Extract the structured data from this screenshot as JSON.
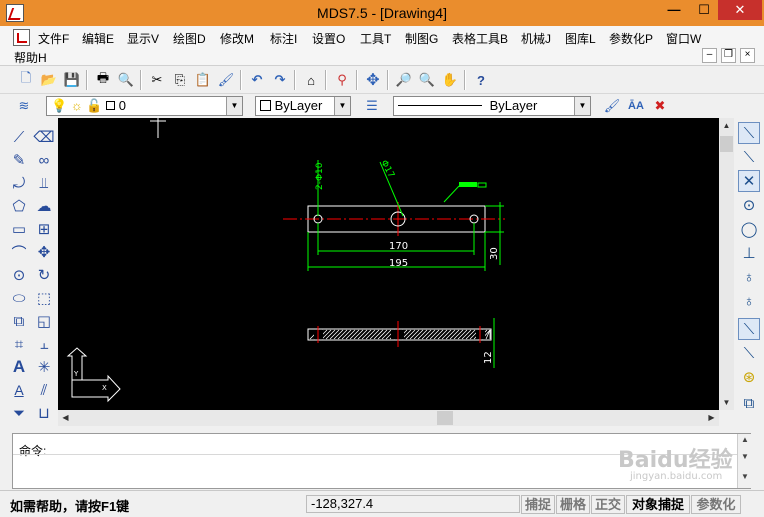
{
  "window": {
    "title": "MDS7.5 - [Drawing4]"
  },
  "menu": {
    "items": [
      "文件F",
      "编辑E",
      "显示V",
      "绘图D",
      "修改M",
      "标注I",
      "设置O",
      "工具T",
      "制图G",
      "表格工具B",
      "机械J",
      "图库L",
      "参数化P",
      "窗口W",
      "帮助H"
    ]
  },
  "props": {
    "layer": "0",
    "color": "ByLayer",
    "linetype": "ByLayer"
  },
  "drawing": {
    "dim_hole": "2-Φ10",
    "dim_center": "Φ17",
    "dim_170": "170",
    "dim_195": "195",
    "dim_30": "30",
    "dim_12": "12",
    "ucs_y": "Y",
    "ucs_x": "X",
    "colors": {
      "outline": "#ffffff",
      "dimension": "#00ff00",
      "center": "#ff0000",
      "hatch": "#ffffff",
      "background": "#000000"
    }
  },
  "command": {
    "prompt": "命令:"
  },
  "status": {
    "help": "如需帮助，请按F1键",
    "coords": "-128,327.4",
    "toggles": [
      {
        "label": "捕捉",
        "on": false
      },
      {
        "label": "栅格",
        "on": false
      },
      {
        "label": "正交",
        "on": false
      },
      {
        "label": "对象捕捉",
        "on": true
      },
      {
        "label": "参数化",
        "on": false
      }
    ]
  },
  "watermark": {
    "brand": "Baidu经验",
    "url": "jingyan.baidu.com"
  }
}
